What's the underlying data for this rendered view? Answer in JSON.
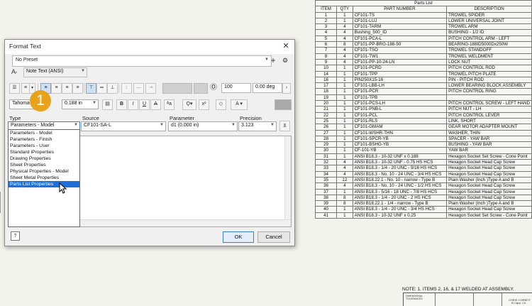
{
  "parts_list": {
    "title": "Parts List",
    "headers": [
      "ITEM",
      "QTY",
      "PART NUMBER",
      "DESCRIPTION"
    ],
    "rows": [
      [
        "1",
        "1",
        "CF101-TS",
        "TROWEL SPIDER"
      ],
      [
        "2",
        "1",
        "CF101-LUJ",
        "LOWER UNIVERSAL JOINT"
      ],
      [
        "3",
        "4",
        "CF101-TARM",
        "TROWEL ARM"
      ],
      [
        "4",
        "4",
        "Bushing_500_ID",
        "BUSHING - 1/2 ID"
      ],
      [
        "5",
        "4",
        "CF101-PCA-L",
        "PITCH CONTROL ARM - LEFT"
      ],
      [
        "6",
        "8",
        "CF101-PP-BRG-188-50",
        "BEARING-188ID5000Dx250W"
      ],
      [
        "7",
        "4",
        "CF101-TSO",
        "TROWEL STANDOFF"
      ],
      [
        "8",
        "4",
        "CF101-TW1",
        "TROWEL WELDMENT"
      ],
      [
        "9",
        "4",
        "CF101-PP-10-24-LN",
        "LOCK NUT"
      ],
      [
        "10",
        "1",
        "CF101-PCRD",
        "PITCH CONTROL ROD"
      ],
      [
        "14",
        "1",
        "CF101-TPP",
        "TROWEL PITCH PLATE"
      ],
      [
        "16",
        "1",
        "PIN250X15-16",
        "PIN - PITCH ROD"
      ],
      [
        "17",
        "1",
        "CF101-LBB-LH",
        "LOWER BEARING BLOCK ASSEMBLY"
      ],
      [
        "18",
        "1",
        "CF101-PCR",
        "PITCH CONTROL RING"
      ],
      [
        "19",
        "1",
        "CF101-TPB",
        ""
      ],
      [
        "20",
        "1",
        "CF101-PCS-LH",
        "PITCH CONTROL SCREW - LEFT HAND"
      ],
      [
        "21",
        "1",
        "CF101-PNB-L",
        "PITCH NUT - LH"
      ],
      [
        "22",
        "1",
        "CF101-PCL",
        "PITCH CONTROL LEVER"
      ],
      [
        "25",
        "1",
        "CF101-RLS",
        "LINK, SHORT"
      ],
      [
        "26",
        "1",
        "CF101-GMAM",
        "GEAR MOTOR ADAPTER MOUNT"
      ],
      [
        "27",
        "1",
        "CF101-WSHR-THN",
        "WASHER, THIN"
      ],
      [
        "28",
        "1",
        "CF101-SPCR-YB",
        "SPACER - YAW BAR"
      ],
      [
        "29",
        "1",
        "CF101-BSHG-YB",
        "BUSHING - YAW BAR"
      ],
      [
        "30",
        "1",
        "CF-101-YB",
        "YAW BAR"
      ],
      [
        "31",
        "1",
        "ANSI B18.3 - 10-32 UNF x 0.188",
        "Hexagon Socket Set Screw - Cone Point"
      ],
      [
        "32",
        "4",
        "ANSI B18.3 - 10-32 UNF - 0.75 HS HCS",
        "Hexagon Socket Head Cap Screw"
      ],
      [
        "33",
        "4",
        "ANSI B18.3 - 1/4 - 20 UNC - 9/16 HS HCS",
        "Hexagon Socket Head Cap Screw"
      ],
      [
        "34",
        "4",
        "ANSI B18.3 - No. 10 - 24 UNC - 3/4 HS HCS",
        "Hexagon Socket Head Cap Screw"
      ],
      [
        "35",
        "12",
        "ANSI B18.22.1 - No. 10 - narrow - Type B",
        "Plain Washer (Inch )Type A and B"
      ],
      [
        "36",
        "4",
        "ANSI B18.3 - No. 10 - 24 UNC - 1/2 HS HCS",
        "Hexagon Socket Head Cap Screw"
      ],
      [
        "37",
        "1",
        "ANSI B18.3 - 5/16 - 18 UNC - 7/8 HS HCS",
        "Hexagon Socket Head Cap Screw"
      ],
      [
        "38",
        "8",
        "ANSI B18.3 - 1/4 - 20 UNC - 2 HS HCS",
        "Hexagon Socket Head Cap Screw"
      ],
      [
        "39",
        "8",
        "ANSI B18.22.1 - 1/4 - narrow - Type B",
        "Plain Washer (Inch )Type A and B"
      ],
      [
        "40",
        "1",
        "ANSI B18.3 - 1/4 - 20 UNC - 3/4 HS HCS",
        "Hexagon Socket Head Cap Screw"
      ],
      [
        "41",
        "1",
        "ANSI B18.3 - 10-32 UNF x 0.25",
        "Hexagon Socket Set Screw - Cone Point"
      ]
    ]
  },
  "note": "NOTE: 1. ITEMS 2, 16, & 17 WELDED AT ASSEMBLY.",
  "title_block": {
    "tolerances": "DIMENSIONAL TOLERANCES",
    "author": "CHRIS CORBITT",
    "location": "El Cajon, CA"
  },
  "dialog": {
    "title": "Format Text",
    "close": "✕",
    "preset": "No Preset",
    "add": "+",
    "text_style": "Note Text (ANSI)",
    "font": "Tahoma",
    "size": "0.188 in",
    "stretch": "100",
    "rotation": "0.00 deg",
    "labels": {
      "type": "Type",
      "source": "Source",
      "parameter": "Parameter",
      "precision": "Precision"
    },
    "type_value": "Parameters - Model",
    "source_value": "CF101-SA-L",
    "parameter_value": "d1 (0.000 in)",
    "precision_value": "3.123",
    "ok": "OK",
    "cancel": "Cancel",
    "help": "?",
    "type_options": [
      "Parameters - Model",
      "Parameters - Finish",
      "Parameters - User",
      "Standard iProperties",
      "Drawing Properties",
      "Sheet Properties",
      "Physical Properties - Model",
      "Sheet Metal Properties",
      "Parts List Properties"
    ],
    "selected_option_index": 8
  },
  "step_badge": "1",
  "colors": {
    "selection": "#1e6fd9",
    "badge": "#e8a21b"
  }
}
